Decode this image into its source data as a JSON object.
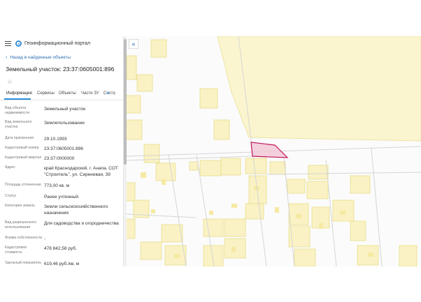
{
  "header": {
    "portal_name": "Геоинформационный портал"
  },
  "nav": {
    "back_label": "Назад в найденные объекты"
  },
  "object": {
    "title": "Земельный участок: 23:37:0605001:896"
  },
  "tabs": [
    {
      "label": "Информация"
    },
    {
      "label": "Сервисы"
    },
    {
      "label": "Объекты"
    },
    {
      "label": "Части ЗУ"
    },
    {
      "label": "Состо"
    }
  ],
  "properties": [
    {
      "key": "Вид объекта недвижимости",
      "value": "Земельный участок"
    },
    {
      "key": "Вид земельного участка",
      "value": "Землепользование"
    },
    {
      "key": "Дата присвоения",
      "value": "29.10.1993"
    },
    {
      "key": "Кадастровый номер",
      "value": "23:37:0605001:896"
    },
    {
      "key": "Кадастровый квартал",
      "value": "23:37:0000000"
    },
    {
      "key": "Адрес",
      "value": "край Краснодарский, г. Анапа, СОТ \"Строитель\", ул. Сиреневая, 39"
    },
    {
      "key": "Площадь уточненная",
      "value": "773,00 кв. м"
    },
    {
      "key": "Статус",
      "value": "Ранее учтенный"
    },
    {
      "key": "Категория земель",
      "value": "Земли сельскохозяйственного назначения"
    },
    {
      "key": "Вид разрешенного использования",
      "value": "Для садоводства и огородничества"
    },
    {
      "key": "Форма собственности",
      "value": "-"
    },
    {
      "key": "Кадастровая стоимость",
      "value": "478 842,58 руб."
    },
    {
      "key": "Удельный показатель",
      "value": "619,46 руб./кв. м"
    }
  ],
  "map": {
    "toggle_icon": "chevrons-left-icon",
    "colors": {
      "parcel_fill": "#faf2c4",
      "parcel_stroke": "#e8dc8a",
      "road": "#ffffff",
      "selected_fill": "#f3c6d6",
      "selected_stroke": "#c2185b",
      "quarter_line": "#d0d0d0"
    }
  }
}
